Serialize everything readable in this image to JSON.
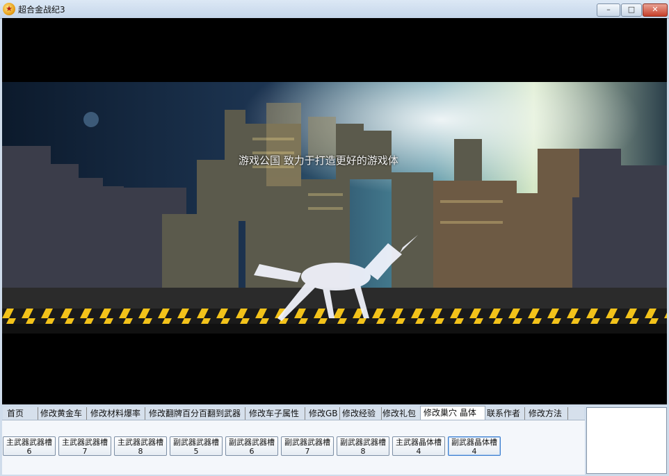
{
  "window": {
    "title": "超合金战纪3",
    "icon": "star-icon",
    "controls": {
      "minimize": "–",
      "maximize": "□",
      "close": "✕"
    }
  },
  "game": {
    "slogan": "游戏公国 致力于打造更好的游戏体"
  },
  "tabs": [
    {
      "label": "首页"
    },
    {
      "label": "修改黄金车"
    },
    {
      "label": "修改材料爆率"
    },
    {
      "label": "修改翻牌百分百翻到武器"
    },
    {
      "label": "修改车子属性"
    },
    {
      "label": "修改GB"
    },
    {
      "label": "修改经验"
    },
    {
      "label": "修改礼包"
    },
    {
      "label": "修改巢穴 晶体",
      "active": true
    },
    {
      "label": "联系作者"
    },
    {
      "label": "修改方法"
    }
  ],
  "slots": [
    {
      "label": "主武器武器槽",
      "value": "6"
    },
    {
      "label": "主武器武器槽",
      "value": "7"
    },
    {
      "label": "主武器武器槽",
      "value": "8"
    },
    {
      "label": "副武器武器槽",
      "value": "5"
    },
    {
      "label": "副武器武器槽",
      "value": "6"
    },
    {
      "label": "副武器武器槽",
      "value": "7"
    },
    {
      "label": "副武器武器槽",
      "value": "8"
    },
    {
      "label": "主武器晶体槽",
      "value": "4"
    },
    {
      "label": "副武器晶体槽",
      "value": "4",
      "focused": true
    }
  ],
  "colors": {
    "titlebar": "#c5d6ea",
    "hazard_yellow": "#f2c21a",
    "game_bg": "#000000"
  }
}
